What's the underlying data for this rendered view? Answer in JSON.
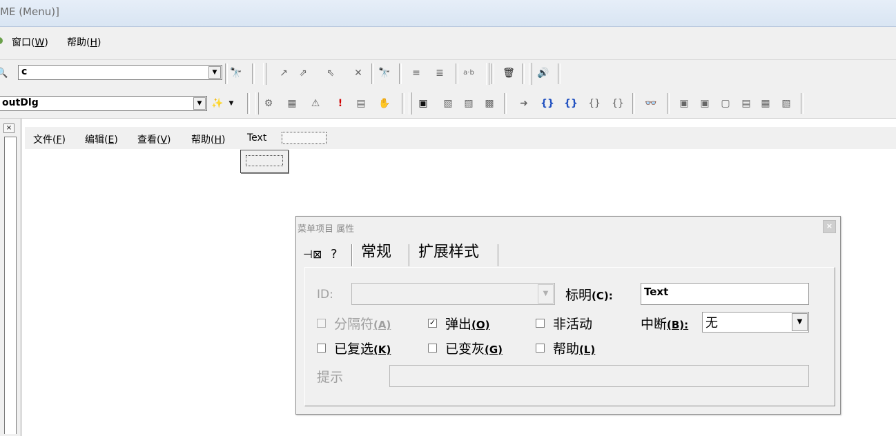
{
  "window": {
    "title": "ME (Menu)]"
  },
  "menubar": {
    "items": [
      {
        "label": "窗口(",
        "acc": "W",
        "end": ")"
      },
      {
        "label": "帮助(",
        "acc": "H",
        "end": ")"
      }
    ]
  },
  "toolbar": {
    "find_combo_value": "c",
    "class_combo_value": "outDlg"
  },
  "menu_editor": {
    "items": [
      {
        "label": "文件(",
        "acc": "F",
        "end": ")"
      },
      {
        "label": "编辑(",
        "acc": "E",
        "end": ")"
      },
      {
        "label": "查看(",
        "acc": "V",
        "end": ")"
      },
      {
        "label": "帮助(",
        "acc": "H",
        "end": ")"
      }
    ],
    "current_item": "Text"
  },
  "dialog": {
    "title": "菜单项目 属性",
    "tabs": [
      "常规",
      "扩展样式"
    ],
    "id_label": "ID:",
    "id_value": "",
    "caption_label": "标明",
    "caption_acc": "(C):",
    "caption_value": "Text",
    "separator_label": "分隔符",
    "separator_acc": "(A)",
    "separator_checked": false,
    "popup_label": "弹出",
    "popup_acc": "(O)",
    "popup_checked": true,
    "inactive_label": "非活动",
    "inactive_checked": false,
    "break_label": "中断",
    "break_acc": "(B):",
    "break_value": "无",
    "checked_label": "已复选",
    "checked_acc": "(K)",
    "checked_checked": false,
    "grayed_label": "已变灰",
    "grayed_acc": "(G)",
    "grayed_checked": false,
    "help_label": "帮助",
    "help_acc": "(L)",
    "help_checked": false,
    "prompt_label": "提示",
    "prompt_value": ""
  },
  "icons": [
    "find-icon",
    "find-in-files-icon",
    "wizard-icon",
    "delete-icon",
    "speaker-icon",
    "close-icon",
    "pin-icon",
    "help-icon"
  ],
  "colors": {
    "title_bar": "#dce7f5",
    "chrome": "#f0f0f0",
    "disabled_text": "#a0a0a0"
  }
}
